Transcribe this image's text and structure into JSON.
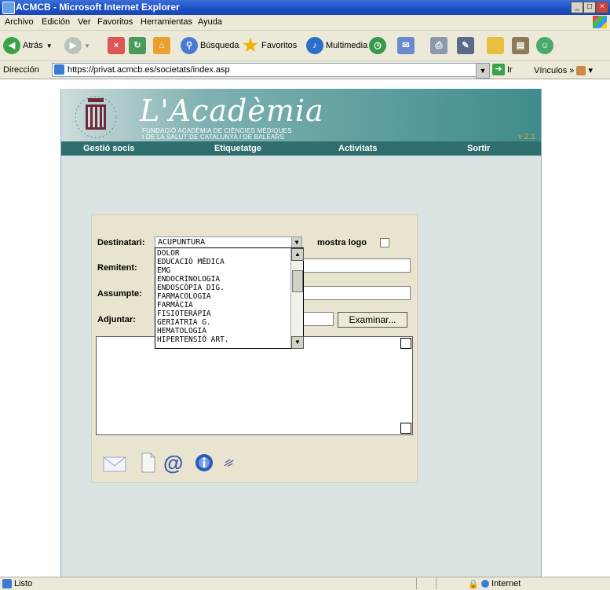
{
  "window": {
    "title": "ACMCB - Microsoft Internet Explorer",
    "minimize": "_",
    "maximize": "□",
    "close": "×"
  },
  "menu": [
    "Archivo",
    "Edición",
    "Ver",
    "Favoritos",
    "Herramientas",
    "Ayuda"
  ],
  "toolbar": {
    "back": "Atrás",
    "search": "Búsqueda",
    "favorites": "Favoritos",
    "multimedia": "Multimedia"
  },
  "address": {
    "label": "Dirección",
    "url": "https://privat.acmcb.es/societats/index.asp",
    "go": "Ir",
    "links": "Vínculos"
  },
  "site": {
    "brand": "L'Acadèmia",
    "subtitle1": "FUNDACIÓ ACADÈMIA DE CIÈNCIES MÈDIQUES",
    "subtitle2": "I DE LA SALUT DE CATALUNYA I DE BALEARS",
    "version": "v 2.1",
    "nav": [
      "Gestió socis",
      "Etiquetatge",
      "Activitats",
      "Sortir"
    ]
  },
  "form": {
    "destinatari_label": "Destinatari:",
    "destinatari_value": "ACUPUNTURA",
    "logo_label": "mostra logo",
    "remitent_label": "Remitent:",
    "assumpte_label": "Assumpte:",
    "adjuntar_label": "Adjuntar:",
    "browse_label": "Examinar...",
    "options": [
      "DOLOR",
      "EDUCACIÓ MÈDICA",
      "EMG",
      "ENDOCRINOLOGIA",
      "ENDOSCÒPIA DIG.",
      "FARMACOLOGIA",
      "FARMÀCIA",
      "FISIOTERÀPIA",
      "GERIATRIA G.",
      "HEMATOLOGIA",
      "HIPERTENSIÓ ART."
    ]
  },
  "status": {
    "text": "Listo",
    "zone": "Internet"
  }
}
